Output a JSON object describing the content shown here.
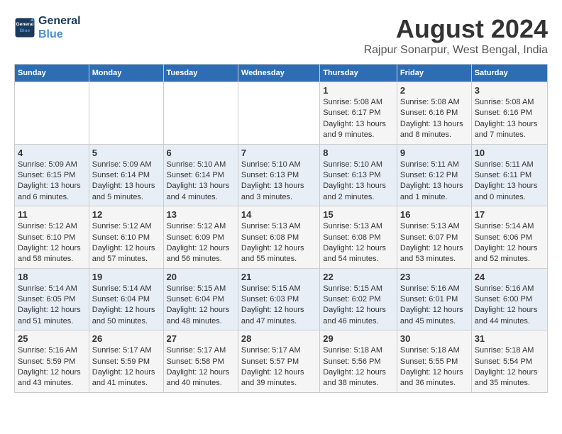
{
  "header": {
    "logo_line1": "General",
    "logo_line2": "Blue",
    "month_year": "August 2024",
    "location": "Rajpur Sonarpur, West Bengal, India"
  },
  "weekdays": [
    "Sunday",
    "Monday",
    "Tuesday",
    "Wednesday",
    "Thursday",
    "Friday",
    "Saturday"
  ],
  "weeks": [
    [
      {
        "day": "",
        "sunrise": "",
        "sunset": "",
        "daylight": ""
      },
      {
        "day": "",
        "sunrise": "",
        "sunset": "",
        "daylight": ""
      },
      {
        "day": "",
        "sunrise": "",
        "sunset": "",
        "daylight": ""
      },
      {
        "day": "",
        "sunrise": "",
        "sunset": "",
        "daylight": ""
      },
      {
        "day": "1",
        "sunrise": "Sunrise: 5:08 AM",
        "sunset": "Sunset: 6:17 PM",
        "daylight": "Daylight: 13 hours and 9 minutes."
      },
      {
        "day": "2",
        "sunrise": "Sunrise: 5:08 AM",
        "sunset": "Sunset: 6:16 PM",
        "daylight": "Daylight: 13 hours and 8 minutes."
      },
      {
        "day": "3",
        "sunrise": "Sunrise: 5:08 AM",
        "sunset": "Sunset: 6:16 PM",
        "daylight": "Daylight: 13 hours and 7 minutes."
      }
    ],
    [
      {
        "day": "4",
        "sunrise": "Sunrise: 5:09 AM",
        "sunset": "Sunset: 6:15 PM",
        "daylight": "Daylight: 13 hours and 6 minutes."
      },
      {
        "day": "5",
        "sunrise": "Sunrise: 5:09 AM",
        "sunset": "Sunset: 6:14 PM",
        "daylight": "Daylight: 13 hours and 5 minutes."
      },
      {
        "day": "6",
        "sunrise": "Sunrise: 5:10 AM",
        "sunset": "Sunset: 6:14 PM",
        "daylight": "Daylight: 13 hours and 4 minutes."
      },
      {
        "day": "7",
        "sunrise": "Sunrise: 5:10 AM",
        "sunset": "Sunset: 6:13 PM",
        "daylight": "Daylight: 13 hours and 3 minutes."
      },
      {
        "day": "8",
        "sunrise": "Sunrise: 5:10 AM",
        "sunset": "Sunset: 6:13 PM",
        "daylight": "Daylight: 13 hours and 2 minutes."
      },
      {
        "day": "9",
        "sunrise": "Sunrise: 5:11 AM",
        "sunset": "Sunset: 6:12 PM",
        "daylight": "Daylight: 13 hours and 1 minute."
      },
      {
        "day": "10",
        "sunrise": "Sunrise: 5:11 AM",
        "sunset": "Sunset: 6:11 PM",
        "daylight": "Daylight: 13 hours and 0 minutes."
      }
    ],
    [
      {
        "day": "11",
        "sunrise": "Sunrise: 5:12 AM",
        "sunset": "Sunset: 6:10 PM",
        "daylight": "Daylight: 12 hours and 58 minutes."
      },
      {
        "day": "12",
        "sunrise": "Sunrise: 5:12 AM",
        "sunset": "Sunset: 6:10 PM",
        "daylight": "Daylight: 12 hours and 57 minutes."
      },
      {
        "day": "13",
        "sunrise": "Sunrise: 5:12 AM",
        "sunset": "Sunset: 6:09 PM",
        "daylight": "Daylight: 12 hours and 56 minutes."
      },
      {
        "day": "14",
        "sunrise": "Sunrise: 5:13 AM",
        "sunset": "Sunset: 6:08 PM",
        "daylight": "Daylight: 12 hours and 55 minutes."
      },
      {
        "day": "15",
        "sunrise": "Sunrise: 5:13 AM",
        "sunset": "Sunset: 6:08 PM",
        "daylight": "Daylight: 12 hours and 54 minutes."
      },
      {
        "day": "16",
        "sunrise": "Sunrise: 5:13 AM",
        "sunset": "Sunset: 6:07 PM",
        "daylight": "Daylight: 12 hours and 53 minutes."
      },
      {
        "day": "17",
        "sunrise": "Sunrise: 5:14 AM",
        "sunset": "Sunset: 6:06 PM",
        "daylight": "Daylight: 12 hours and 52 minutes."
      }
    ],
    [
      {
        "day": "18",
        "sunrise": "Sunrise: 5:14 AM",
        "sunset": "Sunset: 6:05 PM",
        "daylight": "Daylight: 12 hours and 51 minutes."
      },
      {
        "day": "19",
        "sunrise": "Sunrise: 5:14 AM",
        "sunset": "Sunset: 6:04 PM",
        "daylight": "Daylight: 12 hours and 50 minutes."
      },
      {
        "day": "20",
        "sunrise": "Sunrise: 5:15 AM",
        "sunset": "Sunset: 6:04 PM",
        "daylight": "Daylight: 12 hours and 48 minutes."
      },
      {
        "day": "21",
        "sunrise": "Sunrise: 5:15 AM",
        "sunset": "Sunset: 6:03 PM",
        "daylight": "Daylight: 12 hours and 47 minutes."
      },
      {
        "day": "22",
        "sunrise": "Sunrise: 5:15 AM",
        "sunset": "Sunset: 6:02 PM",
        "daylight": "Daylight: 12 hours and 46 minutes."
      },
      {
        "day": "23",
        "sunrise": "Sunrise: 5:16 AM",
        "sunset": "Sunset: 6:01 PM",
        "daylight": "Daylight: 12 hours and 45 minutes."
      },
      {
        "day": "24",
        "sunrise": "Sunrise: 5:16 AM",
        "sunset": "Sunset: 6:00 PM",
        "daylight": "Daylight: 12 hours and 44 minutes."
      }
    ],
    [
      {
        "day": "25",
        "sunrise": "Sunrise: 5:16 AM",
        "sunset": "Sunset: 5:59 PM",
        "daylight": "Daylight: 12 hours and 43 minutes."
      },
      {
        "day": "26",
        "sunrise": "Sunrise: 5:17 AM",
        "sunset": "Sunset: 5:59 PM",
        "daylight": "Daylight: 12 hours and 41 minutes."
      },
      {
        "day": "27",
        "sunrise": "Sunrise: 5:17 AM",
        "sunset": "Sunset: 5:58 PM",
        "daylight": "Daylight: 12 hours and 40 minutes."
      },
      {
        "day": "28",
        "sunrise": "Sunrise: 5:17 AM",
        "sunset": "Sunset: 5:57 PM",
        "daylight": "Daylight: 12 hours and 39 minutes."
      },
      {
        "day": "29",
        "sunrise": "Sunrise: 5:18 AM",
        "sunset": "Sunset: 5:56 PM",
        "daylight": "Daylight: 12 hours and 38 minutes."
      },
      {
        "day": "30",
        "sunrise": "Sunrise: 5:18 AM",
        "sunset": "Sunset: 5:55 PM",
        "daylight": "Daylight: 12 hours and 36 minutes."
      },
      {
        "day": "31",
        "sunrise": "Sunrise: 5:18 AM",
        "sunset": "Sunset: 5:54 PM",
        "daylight": "Daylight: 12 hours and 35 minutes."
      }
    ]
  ]
}
